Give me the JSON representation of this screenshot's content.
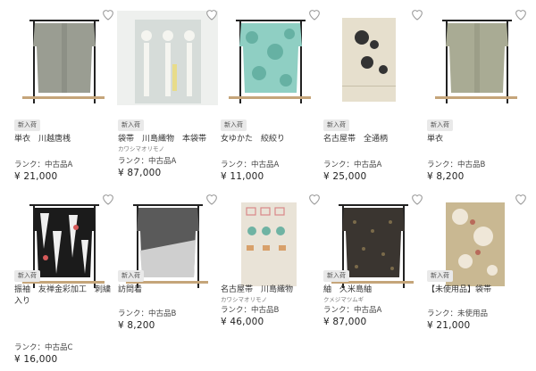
{
  "heart_color": "#9a9a9a",
  "items": [
    {
      "badge": "新入荷",
      "title": "単衣　川越唐桟",
      "maker": "",
      "rank": "ランク：中古品A",
      "price": "¥ 21,000"
    },
    {
      "badge": "新入荷",
      "title": "袋帯　川島織物　本袋帯",
      "maker": "カワシマオリモノ",
      "rank": "ランク：中古品A",
      "price": "¥ 87,000"
    },
    {
      "badge": "新入荷",
      "title": "女ゆかた　絞絞り",
      "maker": "",
      "rank": "ランク：中古品A",
      "price": "¥ 11,000"
    },
    {
      "badge": "新入荷",
      "title": "名古屋帯　全通柄",
      "maker": "",
      "rank": "ランク：中古品A",
      "price": "¥ 25,000"
    },
    {
      "badge": "新入荷",
      "title": "単衣",
      "maker": "",
      "rank": "ランク：中古品B",
      "price": "¥ 8,200"
    },
    {
      "badge": "新入荷",
      "title": "振袖　友禅金彩加工　刺繍入り",
      "maker": "",
      "rank": "ランク：中古品C",
      "price": "¥ 16,000"
    },
    {
      "badge": "新入荷",
      "title": "訪問着",
      "maker": "",
      "rank": "ランク：中古品B",
      "price": "¥ 8,200"
    },
    {
      "badge": "",
      "title": "名古屋帯　川島織物",
      "maker": "カワシマオリモノ",
      "rank": "ランク：中古品B",
      "price": "¥ 46,000"
    },
    {
      "badge": "新入荷",
      "title": "紬　久米島紬",
      "maker": "クメジマツムギ",
      "rank": "ランク：中古品A",
      "price": "¥ 87,000"
    },
    {
      "badge": "新入荷",
      "title": "【未使用品】袋帯",
      "maker": "",
      "rank": "ランク：未使用品",
      "price": "¥ 21,000"
    }
  ]
}
